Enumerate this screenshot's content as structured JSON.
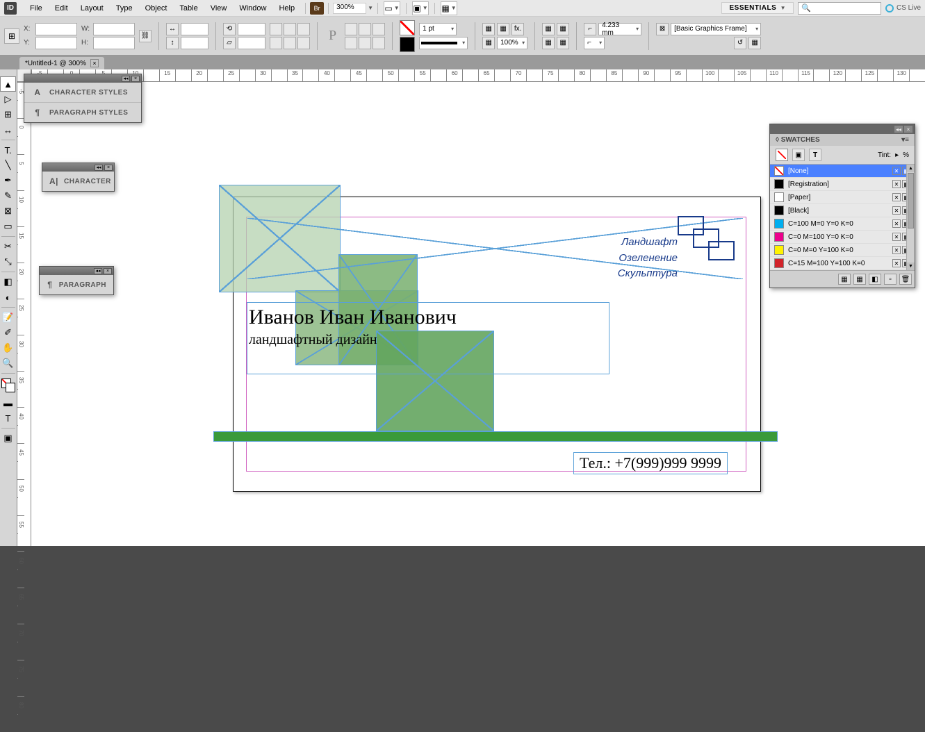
{
  "menu": {
    "items": [
      "File",
      "Edit",
      "Layout",
      "Type",
      "Object",
      "Table",
      "View",
      "Window",
      "Help"
    ],
    "zoom": "300%",
    "workspace": "ESSENTIALS",
    "cslive": "CS Live",
    "br": "Br"
  },
  "control": {
    "x_label": "X:",
    "x_val": "",
    "y_label": "Y:",
    "y_val": "",
    "w_label": "W:",
    "w_val": "",
    "h_label": "H:",
    "h_val": "",
    "stroke_weight": "1 pt",
    "scale_pct": "100%",
    "rule_val": "4.233 mm",
    "style_name": "[Basic Graphics Frame]",
    "fx": "fx."
  },
  "doctab": {
    "title": "*Untitled-1 @ 300%"
  },
  "panels": {
    "styles": {
      "char_styles": "CHARACTER STYLES",
      "para_styles": "PARAGRAPH STYLES"
    },
    "character": {
      "title": "CHARACTER"
    },
    "paragraph": {
      "title": "PARAGRAPH"
    }
  },
  "swatches": {
    "title": "SWATCHES",
    "tint_label": "Tint:",
    "tint_unit": "%",
    "items": [
      {
        "name": "[None]",
        "color": "none",
        "selected": true
      },
      {
        "name": "[Registration]",
        "color": "#000000"
      },
      {
        "name": "[Paper]",
        "color": "#ffffff"
      },
      {
        "name": "[Black]",
        "color": "#000000"
      },
      {
        "name": "C=100 M=0 Y=0 K=0",
        "color": "#00aeef"
      },
      {
        "name": "C=0 M=100 Y=0 K=0",
        "color": "#ec008c"
      },
      {
        "name": "C=0 M=0 Y=100 K=0",
        "color": "#fff200"
      },
      {
        "name": "C=15 M=100 Y=100 K=0",
        "color": "#d2232a"
      }
    ]
  },
  "ruler_h": [
    -5,
    0,
    5,
    10,
    15,
    20,
    25,
    30,
    35,
    40,
    45,
    50,
    55,
    60,
    65,
    70,
    75,
    80,
    85,
    90,
    95,
    100,
    105,
    110,
    115,
    120,
    125,
    130
  ],
  "ruler_v": [
    -5,
    0,
    5,
    10,
    15,
    20,
    25,
    30,
    35,
    40,
    45,
    50,
    55,
    60,
    65,
    70,
    75,
    80
  ],
  "card": {
    "name": "Иванов Иван Иванович",
    "subtitle": "ландшафтный дизайн",
    "tel": "Тел.: +7(999)999 9999",
    "logo_lines": [
      "Ландшафт",
      "Озеленение",
      "Скульптура"
    ]
  }
}
